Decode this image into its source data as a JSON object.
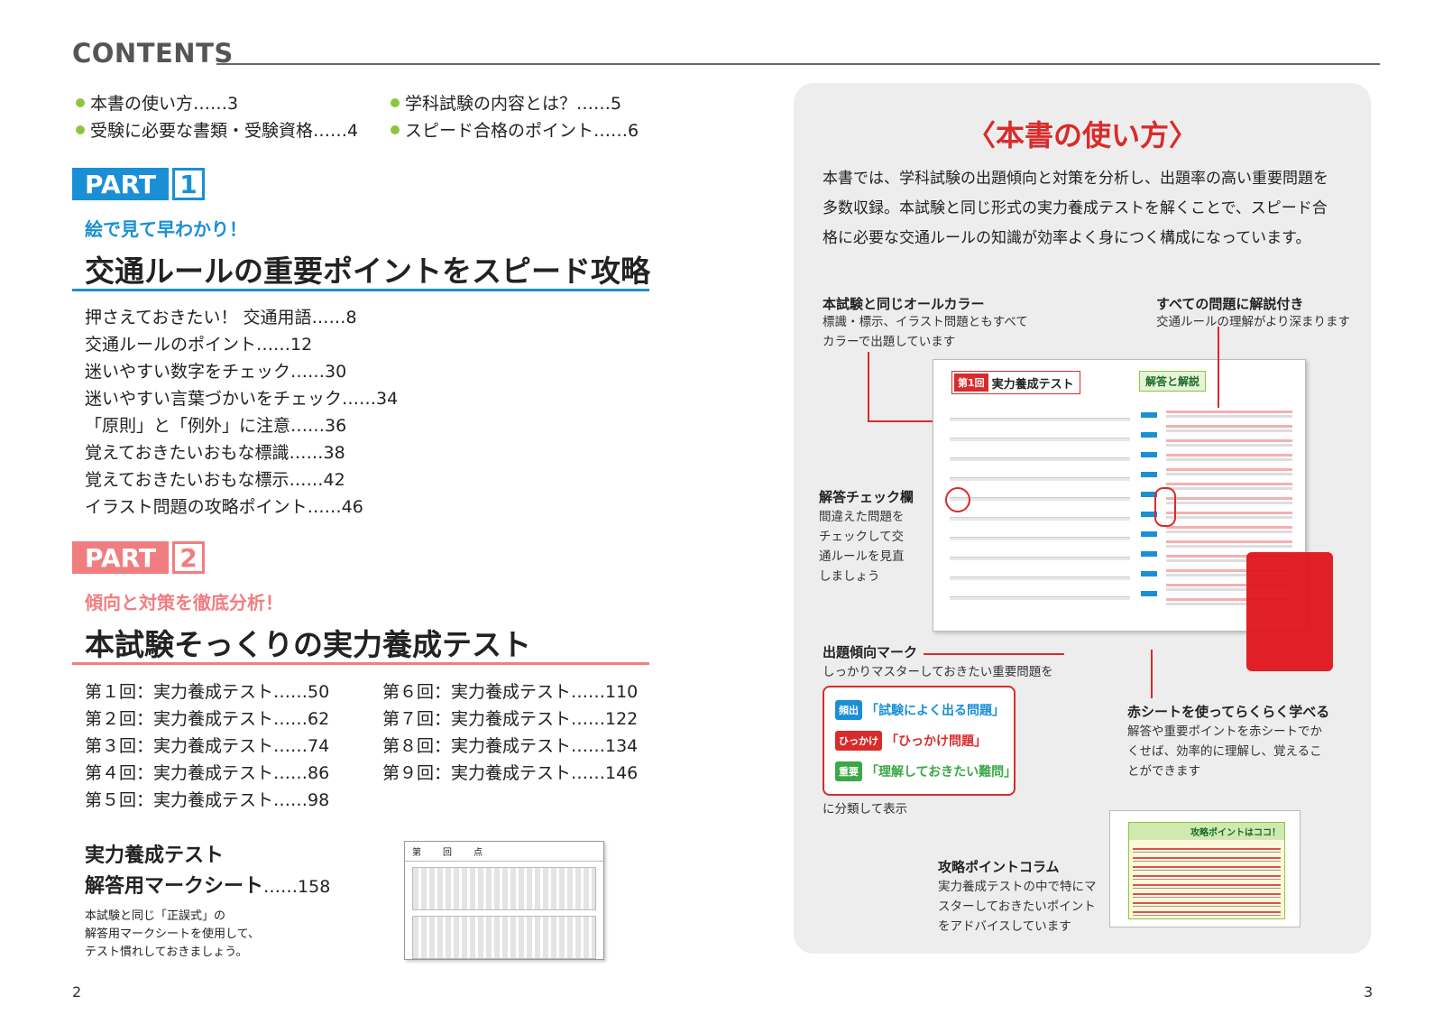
{
  "header": {
    "title": "CONTENTS"
  },
  "intro_items": [
    {
      "label": "本書の使い方……3"
    },
    {
      "label": "受験に必要な書類・受験資格……4"
    },
    {
      "label": "学科試験の内容とは？……5"
    },
    {
      "label": "スピード合格のポイント……6"
    }
  ],
  "part1": {
    "label": "PART",
    "num": "1",
    "subtitle": "絵で見て早わかり！",
    "title": "交通ルールの重要ポイントをスピード攻略",
    "items": [
      "押さえておきたい！ 交通用語……8",
      "交通ルールのポイント……12",
      "迷いやすい数字をチェック……30",
      "迷いやすい言葉づかいをチェック……34",
      "「原則」と「例外」に注意……36",
      "覚えておきたいおもな標識……38",
      "覚えておきたいおもな標示……42",
      "イラスト問題の攻略ポイント……46"
    ]
  },
  "part2": {
    "label": "PART",
    "num": "2",
    "subtitle": "傾向と対策を徹底分析！",
    "title": "本試験そっくりの実力養成テスト",
    "tests_left": [
      "第１回：実力養成テスト……50",
      "第２回：実力養成テスト……62",
      "第３回：実力養成テスト……74",
      "第４回：実力養成テスト……86",
      "第５回：実力養成テスト……98"
    ],
    "tests_right": [
      "第６回：実力養成テスト……110",
      "第７回：実力養成テスト……122",
      "第８回：実力養成テスト……134",
      "第９回：実力養成テスト……146"
    ]
  },
  "marksheet": {
    "title1": "実力養成テスト",
    "title2": "解答用マークシート",
    "page": "……158",
    "desc": [
      "本試験と同じ「正誤式」の",
      "解答用マークシートを使用して、",
      "テスト慣れしておきましょう。"
    ],
    "thumb_header": [
      "第",
      "回",
      "点"
    ]
  },
  "howto": {
    "title": "〈本書の使い方〉",
    "intro": [
      "本書では、学科試験の出題傾向と対策を分析し、出題率の高い重要問題を",
      "多数収録。本試験と同じ形式の実力養成テストを解くことで、スピード合",
      "格に必要な交通ルールの知識が効率よく身につく構成になっています。"
    ],
    "ann_color": {
      "head": "本試験と同じオールカラー",
      "lines": [
        "標識・標示、イラスト問題ともすべて",
        "カラーで出題しています"
      ]
    },
    "ann_explain": {
      "head": "すべての問題に解説付き",
      "lines": [
        "交通ルールの理解がより深まります"
      ]
    },
    "ann_check": {
      "head": "解答チェック欄",
      "lines": [
        "間違えた問題を",
        "チェックして交",
        "通ルールを見直",
        "しましょう"
      ]
    },
    "ann_trend": {
      "head": "出題傾向マーク",
      "lines": [
        "しっかりマスターしておきたい重要問題を"
      ]
    },
    "tags": [
      {
        "chip": "頻出",
        "label": "「試験によく出る問題」",
        "color": "#1a8fd6"
      },
      {
        "chip": "ひっかけ",
        "label": "「ひっかけ問題」",
        "color": "#d92b2b"
      },
      {
        "chip": "重要",
        "label": "「理解しておきたい難問」",
        "color": "#3aa845"
      }
    ],
    "tags_footer": "に分類して表示",
    "ann_red": {
      "head": "赤シートを使ってらくらく学べる",
      "lines": [
        "解答や重要ポイントを赤シートでか",
        "くせば、効率的に理解し、覚えるこ",
        "とができます"
      ]
    },
    "ann_column": {
      "head": "攻略ポイントコラム",
      "lines": [
        "実力養成テストの中で特にマ",
        "スターしておきたいポイント",
        "をアドバイスしています"
      ]
    },
    "sample": {
      "tab": "第1回",
      "title": "実力養成テスト",
      "answer_title": "解答と解説",
      "column_title": "攻略ポイントはココ！"
    }
  },
  "pages": {
    "left": "2",
    "right": "3"
  },
  "colors": {
    "blue": "#1a8fd6",
    "pink": "#f07e80",
    "red": "#d92b2b",
    "green": "#8cc63f"
  }
}
